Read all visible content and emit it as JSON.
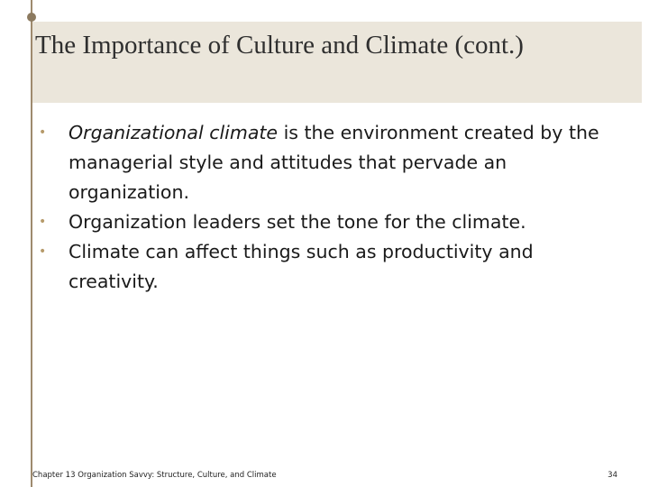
{
  "slide": {
    "title": "The Importance of Culture and Climate (cont.)",
    "bullets": [
      {
        "emphasis": "Organizational climate",
        "text": " is the environment created by the managerial style and attitudes that pervade an organization."
      },
      {
        "emphasis": "",
        "text": "Organization leaders set the tone for the climate."
      },
      {
        "emphasis": "",
        "text": "Climate can affect things such as productivity and creativity."
      }
    ],
    "bullet_glyph": "•",
    "footer": {
      "chapter": "Chapter 13 Organization Savvy: Structure, Culture, and Climate",
      "page_number": "34"
    }
  },
  "colors": {
    "title_band": "#ebe6db",
    "accent_line": "#9e8a6e",
    "bullet": "#b69a6a"
  }
}
